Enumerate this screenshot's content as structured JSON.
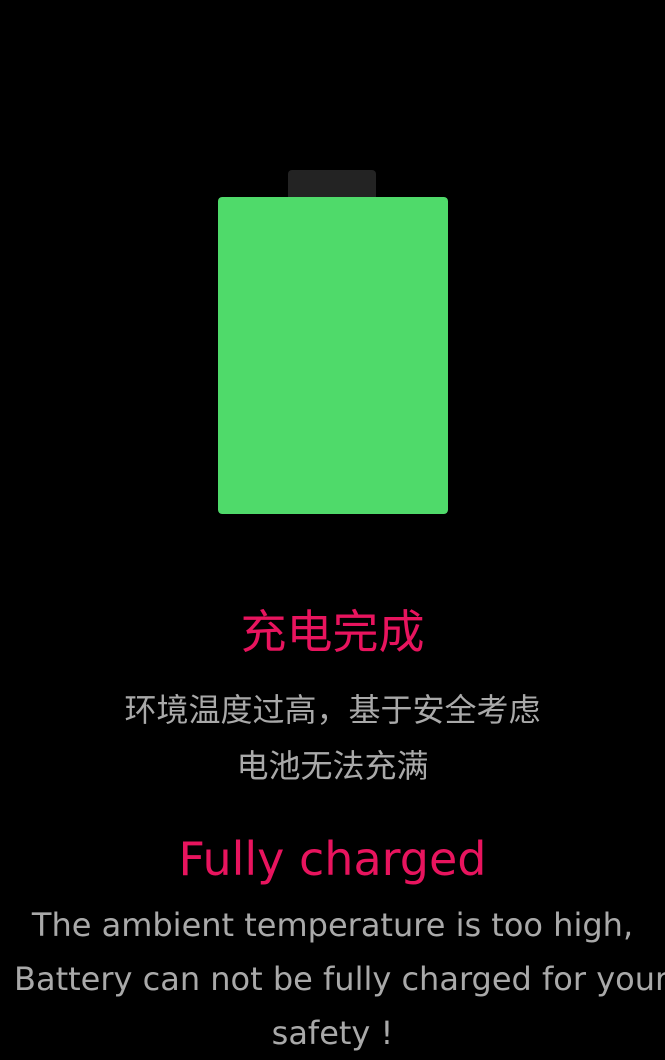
{
  "colors": {
    "background": "#000000",
    "battery_fill": "#4fda6a",
    "battery_cap": "#232323",
    "accent": "#e8145e",
    "secondary_text": "#a9a9a9"
  },
  "battery": {
    "icon": "battery-full-icon",
    "level_percent": 100
  },
  "status_cn": {
    "title": "充电完成",
    "line1": "环境温度过高，基于安全考虑",
    "line2": "电池无法充满"
  },
  "status_en": {
    "title": "Fully charged",
    "line1": "The ambient temperature is too high,",
    "line2": "Battery can not be fully charged for your",
    "line3": "safety !"
  }
}
